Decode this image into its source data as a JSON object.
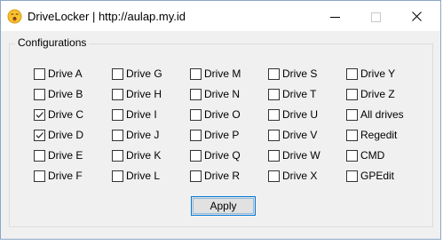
{
  "window": {
    "title": "DriveLocker | http://aulap.my.id"
  },
  "group": {
    "label": "Configurations"
  },
  "checkboxes": [
    {
      "label": "Drive A",
      "checked": false
    },
    {
      "label": "Drive B",
      "checked": false
    },
    {
      "label": "Drive C",
      "checked": true
    },
    {
      "label": "Drive D",
      "checked": true
    },
    {
      "label": "Drive E",
      "checked": false
    },
    {
      "label": "Drive F",
      "checked": false
    },
    {
      "label": "Drive G",
      "checked": false
    },
    {
      "label": "Drive H",
      "checked": false
    },
    {
      "label": "Drive I",
      "checked": false
    },
    {
      "label": "Drive J",
      "checked": false
    },
    {
      "label": "Drive K",
      "checked": false
    },
    {
      "label": "Drive L",
      "checked": false
    },
    {
      "label": "Drive M",
      "checked": false
    },
    {
      "label": "Drive N",
      "checked": false
    },
    {
      "label": "Drive O",
      "checked": false
    },
    {
      "label": "Drive P",
      "checked": false
    },
    {
      "label": "Drive Q",
      "checked": false
    },
    {
      "label": "Drive R",
      "checked": false
    },
    {
      "label": "Drive S",
      "checked": false
    },
    {
      "label": "Drive T",
      "checked": false
    },
    {
      "label": "Drive U",
      "checked": false
    },
    {
      "label": "Drive V",
      "checked": false
    },
    {
      "label": "Drive W",
      "checked": false
    },
    {
      "label": "Drive X",
      "checked": false
    },
    {
      "label": "Drive Y",
      "checked": false
    },
    {
      "label": "Drive Z",
      "checked": false
    },
    {
      "label": "All drives",
      "checked": false
    },
    {
      "label": "Regedit",
      "checked": false
    },
    {
      "label": "CMD",
      "checked": false
    },
    {
      "label": "GPEdit",
      "checked": false
    }
  ],
  "apply_label": "Apply",
  "icons": {
    "app": "emoji-face-icon",
    "minimize": "minimize-icon",
    "maximize": "maximize-icon",
    "close": "close-icon"
  },
  "colors": {
    "accent": "#0078d7",
    "titlebar": "#ffffff",
    "client": "#f0f0f0",
    "maximize_disabled": "#c8c8c8"
  }
}
